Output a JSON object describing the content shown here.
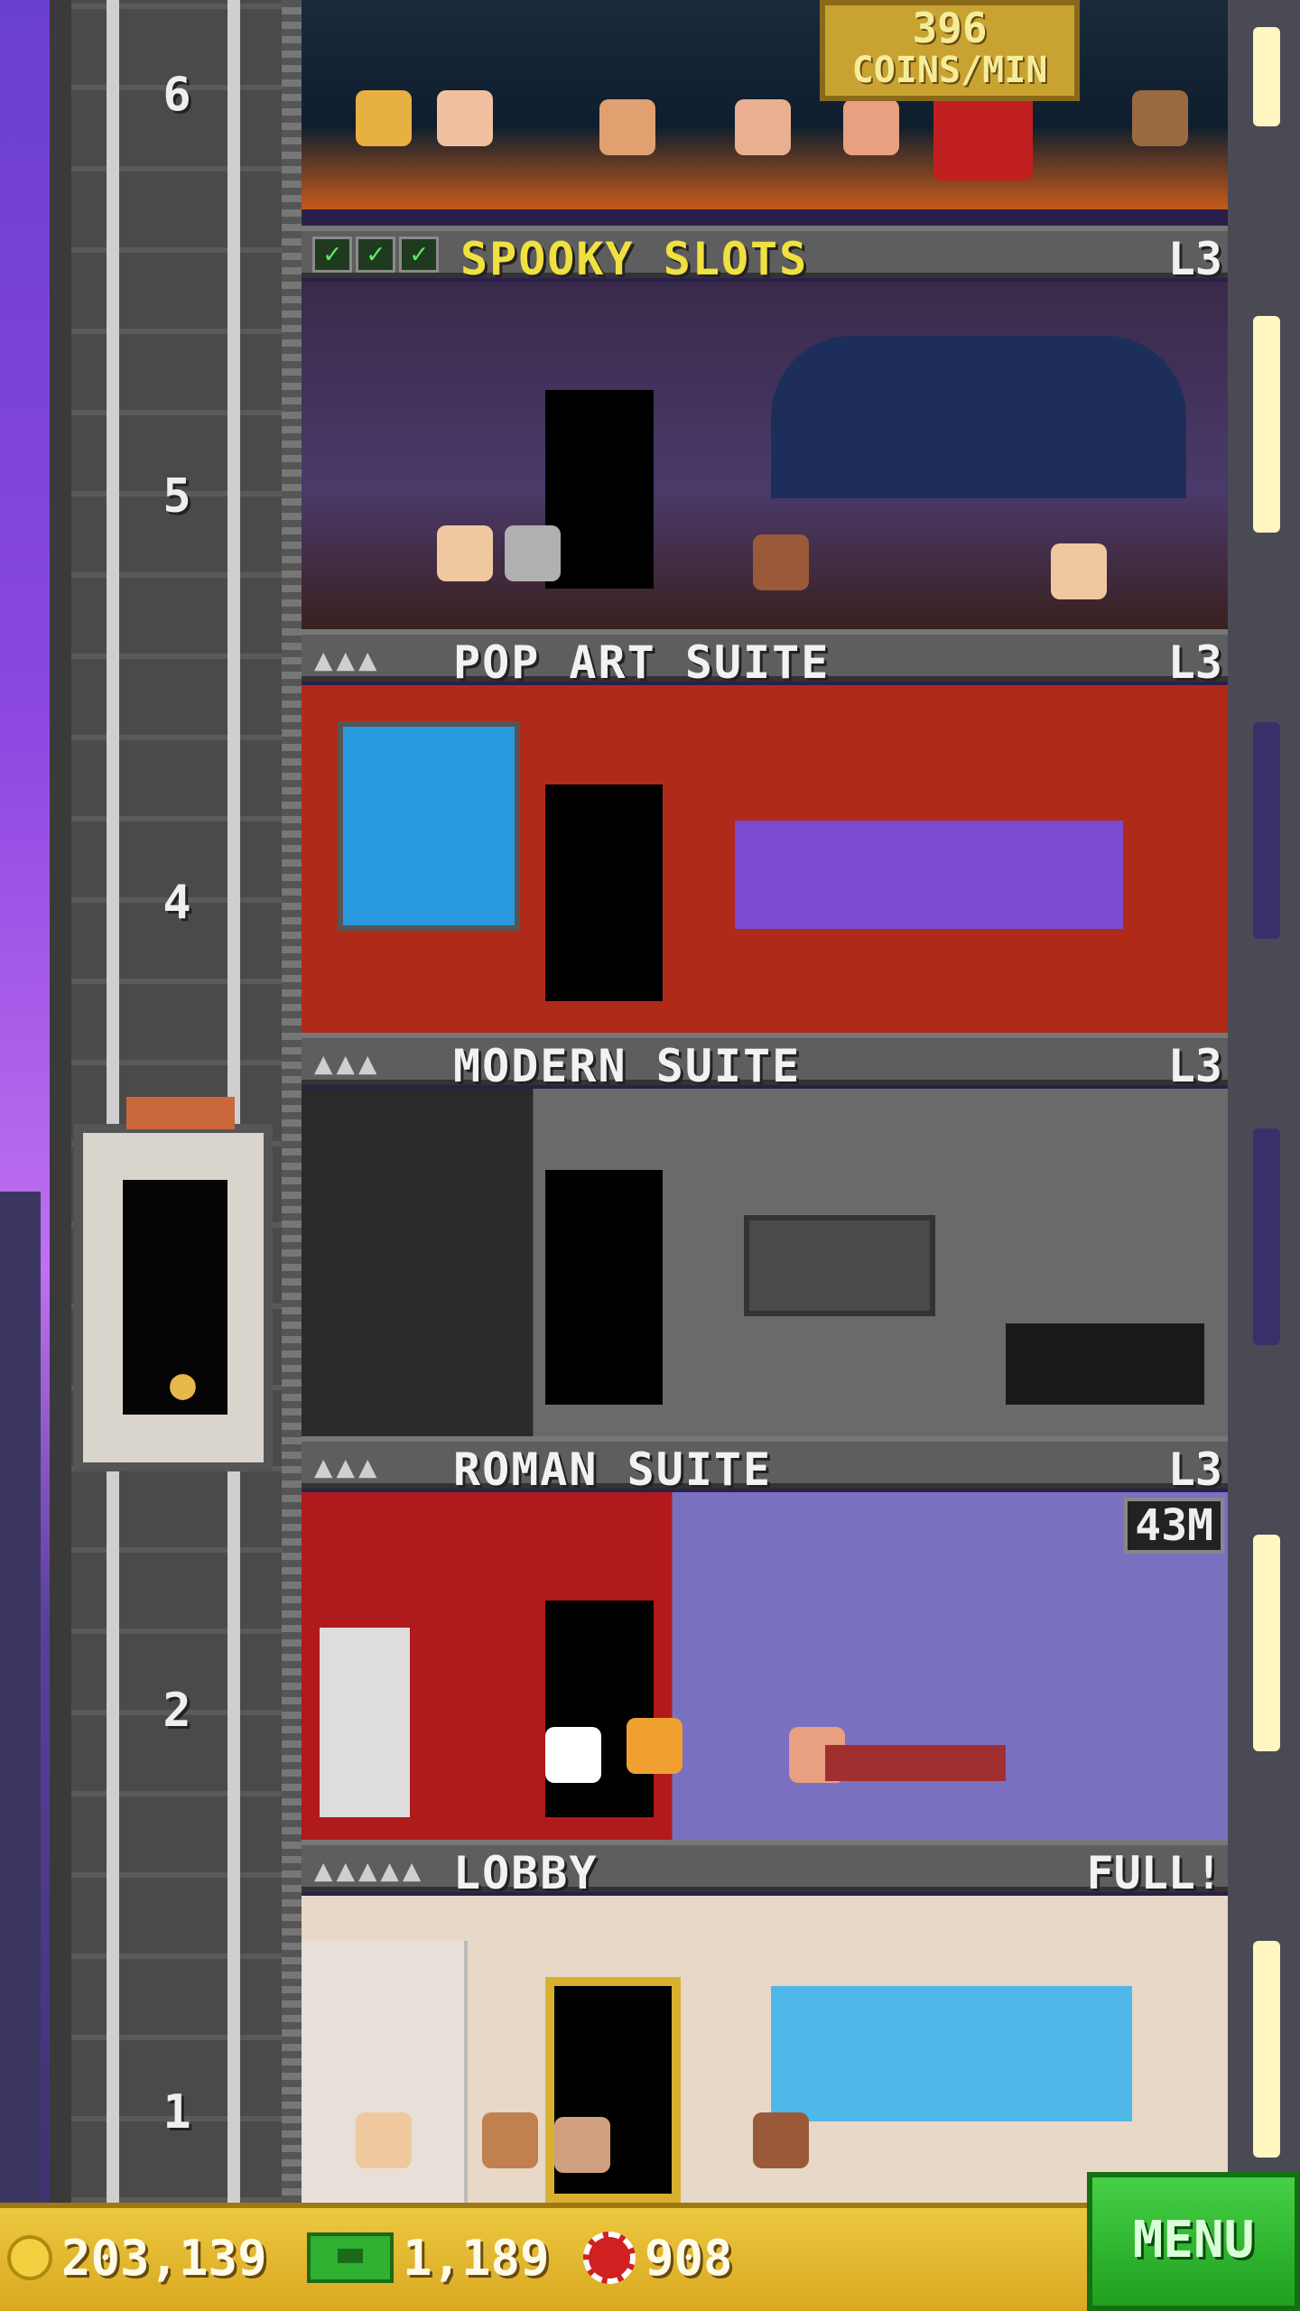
{
  "coins_per_min": {
    "value": "396",
    "unit": "COINS/MIN"
  },
  "floors": [
    {
      "id": "spooky",
      "name": "SPOOKY SLOTS",
      "level": "L3",
      "stocked": 3
    },
    {
      "id": "popart",
      "name": "POP ART SUITE",
      "level": "L3",
      "residents": "▲▲▲"
    },
    {
      "id": "modern",
      "name": "MODERN SUITE",
      "level": "L3",
      "residents": "▲▲▲"
    },
    {
      "id": "roman",
      "name": "ROMAN SUITE",
      "level": "L3",
      "residents": "▲▲▲",
      "timer": "43M"
    },
    {
      "id": "lobby",
      "name": "LOBBY",
      "level": "FULL!",
      "residents": "▲▲▲▲▲"
    }
  ],
  "elevator_floor_numbers": [
    "6",
    "5",
    "4",
    "2",
    "1"
  ],
  "status": {
    "coins": "203,139",
    "bux": "1,189",
    "chips": "908"
  },
  "menu_label": "MENU",
  "colors": {
    "coin": "#f4d040",
    "bux": "#30b030",
    "chip": "#d02020",
    "menu": "#2fb82f",
    "banner_highlight": "#f0e040"
  },
  "icons": [
    "coin-icon",
    "bux-icon",
    "chip-icon",
    "check-icon",
    "person-icon"
  ]
}
